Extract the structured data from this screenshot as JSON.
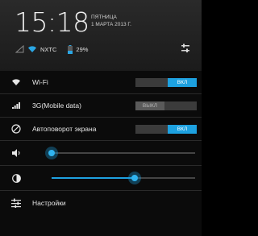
{
  "header": {
    "time": "15:18",
    "weekday": "ПЯТНИЦА",
    "date": "1 МАРТА 2013 Г.",
    "carrier": "NXTC",
    "battery": "29%"
  },
  "quick_settings": {
    "wifi": {
      "label": "Wi-Fi",
      "state": "ВКЛ"
    },
    "mobile_data": {
      "label": "3G(Mobile data)",
      "state": "ВЫКЛ"
    },
    "autorotate": {
      "label": "Автоповорот экрана",
      "state": "ВКЛ"
    },
    "volume": {
      "level_fraction": 0.0
    },
    "brightness": {
      "level_fraction": 0.58
    },
    "settings_label": "Настройки"
  },
  "colors": {
    "accent": "#1da1e0"
  }
}
